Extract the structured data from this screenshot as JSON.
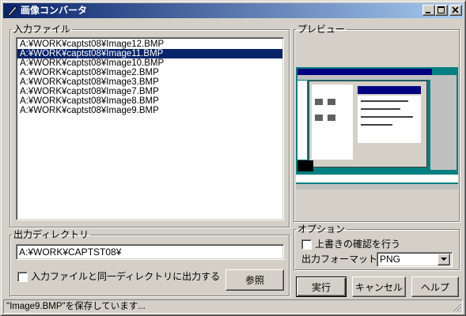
{
  "window": {
    "title": "画像コンバータ"
  },
  "input_group": {
    "label": "入力ファイル",
    "files": [
      "A:¥WORK¥captst08¥Image12.BMP",
      "A:¥WORK¥captst08¥Image11.BMP",
      "A:¥WORK¥captst08¥Image10.BMP",
      "A:¥WORK¥captst08¥Image2.BMP",
      "A:¥WORK¥captst08¥Image3.BMP",
      "A:¥WORK¥captst08¥Image7.BMP",
      "A:¥WORK¥captst08¥Image8.BMP",
      "A:¥WORK¥captst08¥Image9.BMP"
    ],
    "selected_index": 1
  },
  "preview_group": {
    "label": "プレビュー"
  },
  "output_group": {
    "label": "出力ディレクトリ",
    "path": "A:¥WORK¥CAPTST08¥",
    "same_dir_label": "入力ファイルと同一ディレクトリに出力する",
    "same_dir_checked": false,
    "browse_label": "参照"
  },
  "options_group": {
    "label": "オプション",
    "overwrite_confirm_label": "上書きの確認を行う",
    "overwrite_confirm_checked": false,
    "format_label": "出力フォーマット",
    "format_value": "PNG"
  },
  "actions": {
    "run": "実行",
    "cancel": "キャンセル",
    "help": "ヘルプ"
  },
  "status": {
    "text": "\"Image9.BMP\"を保存しています..."
  }
}
